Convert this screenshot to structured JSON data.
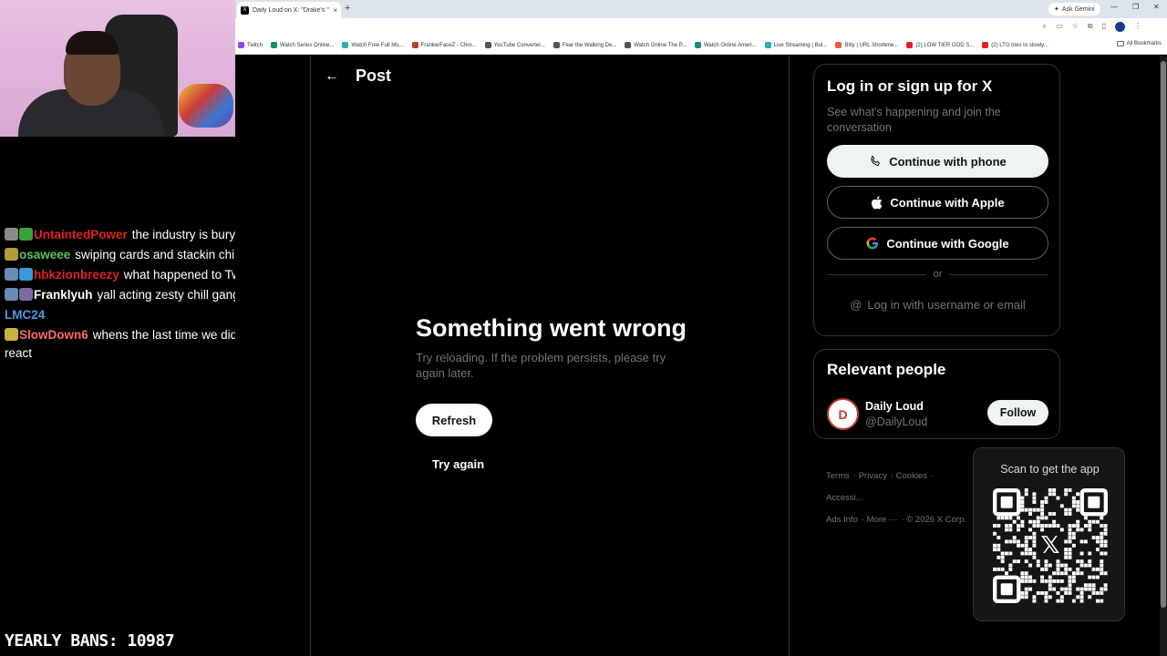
{
  "stream": {
    "chat": [
      {
        "user": "UntaintedPower",
        "color": "#e02020",
        "message": "the industry is burying tyga",
        "badges": [
          "#8a8a8a",
          "#3da03d"
        ]
      },
      {
        "user": "osaweee",
        "color": "#5dc35d",
        "message": "swiping cards and stackin chips",
        "badges": [
          "#b39a3a"
        ]
      },
      {
        "user": "hbkzionbreezy",
        "color": "#e02020",
        "message": "what happened to Twitter?",
        "badges": [
          "#6a8ab5",
          "#3a9ad9"
        ]
      },
      {
        "user": "Franklyuh",
        "color": "#ffffff",
        "message": "yall acting zesty chill gang",
        "badges": [
          "#6a8ab5",
          "#7a6aa5"
        ]
      },
      {
        "user": "LMC24",
        "color": "#4a9ae0",
        "message": "",
        "badges": []
      },
      {
        "user": "SlowDown6",
        "color": "#ff6a6a",
        "message": "whens the last time we did a discord react",
        "badges": [
          "#c8b040"
        ]
      }
    ],
    "banner": "YEARLY BANS: 10987"
  },
  "browser": {
    "tab_title": "Daily Loud on X: \"Drake's \"ICEMAN\"...",
    "tab_favicon": "X",
    "tab_close": "×",
    "new_tab": "+",
    "gemini_label": "Ask Gemini",
    "window_controls": [
      "—",
      "❐",
      "✕"
    ],
    "toolbar_icons": [
      "zoom-icon",
      "screen-icon",
      "star-icon",
      "extensions-icon",
      "profile-icon"
    ],
    "bookmarks": [
      {
        "label": "Twitch",
        "color": "#9146ff"
      },
      {
        "label": "Watch Series Online...",
        "color": "#1a8a7a"
      },
      {
        "label": "Watch Free Full Mo...",
        "color": "#22b0b0"
      },
      {
        "label": "FrankerFaceZ - Chro...",
        "color": "#c0392b"
      },
      {
        "label": "YouTube Converter...",
        "color": "#555555"
      },
      {
        "label": "Fear the Walking De...",
        "color": "#555555"
      },
      {
        "label": "Watch Online The P...",
        "color": "#555555"
      },
      {
        "label": "Watch Online Ameri...",
        "color": "#1a8a7a"
      },
      {
        "label": "Live Streaming | Bul...",
        "color": "#22b0b0"
      },
      {
        "label": "Bitly | URL Shortene...",
        "color": "#e8603a"
      },
      {
        "label": "(2) LOW TIER GOD S...",
        "color": "#e02020"
      },
      {
        "label": "(2) LTG tries to slowly...",
        "color": "#e02020"
      }
    ],
    "all_bookmarks": "All Bookmarks"
  },
  "page": {
    "back_icon": "←",
    "header_title": "Post",
    "error": {
      "title": "Something went wrong",
      "message": "Try reloading. If the problem persists, please try again later.",
      "refresh_label": "Refresh",
      "try_again_label": "Try again"
    },
    "login": {
      "title": "Log in or sign up for X",
      "subtitle": "See what's happening and join the conversation",
      "phone_label": "Continue with phone",
      "apple_label": "Continue with Apple",
      "google_label": "Continue with Google",
      "or_label": "or",
      "username_label": "Log in with username or email"
    },
    "relevant": {
      "title": "Relevant people",
      "name": "Daily Loud",
      "handle": "@DailyLoud",
      "follow_label": "Follow",
      "avatar_letter": "D"
    },
    "footer": [
      "Terms",
      "Privacy",
      "Cookies",
      "Accessi...",
      "Ads Info",
      "More ···",
      "© 2026 X Corp."
    ],
    "qr_title": "Scan to get the app"
  }
}
